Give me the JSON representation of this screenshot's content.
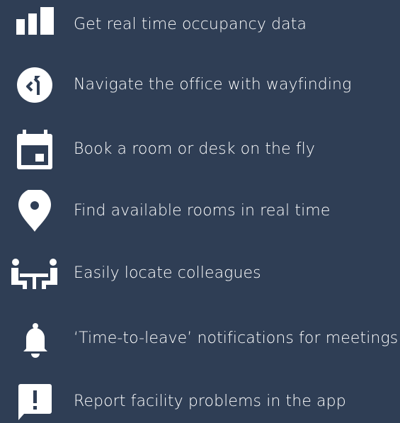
{
  "theme": {
    "background": "#2f3e55",
    "icon_color": "#ffffff",
    "text_color": "#ffffff"
  },
  "features": [
    {
      "icon": "bar-chart-icon",
      "label": "Get real time occupancy data"
    },
    {
      "icon": "wayfinding-icon",
      "label": "Navigate the office with wayfinding"
    },
    {
      "icon": "calendar-icon",
      "label": "Book a room or desk on the fly"
    },
    {
      "icon": "location-pin-icon",
      "label": "Find available rooms in real time"
    },
    {
      "icon": "colleagues-icon",
      "label": "Easily locate colleagues"
    },
    {
      "icon": "bell-icon",
      "label": "‘Time-to-leave’ notifications for meetings"
    },
    {
      "icon": "report-problem-icon",
      "label": "Report facility problems in the app"
    }
  ]
}
